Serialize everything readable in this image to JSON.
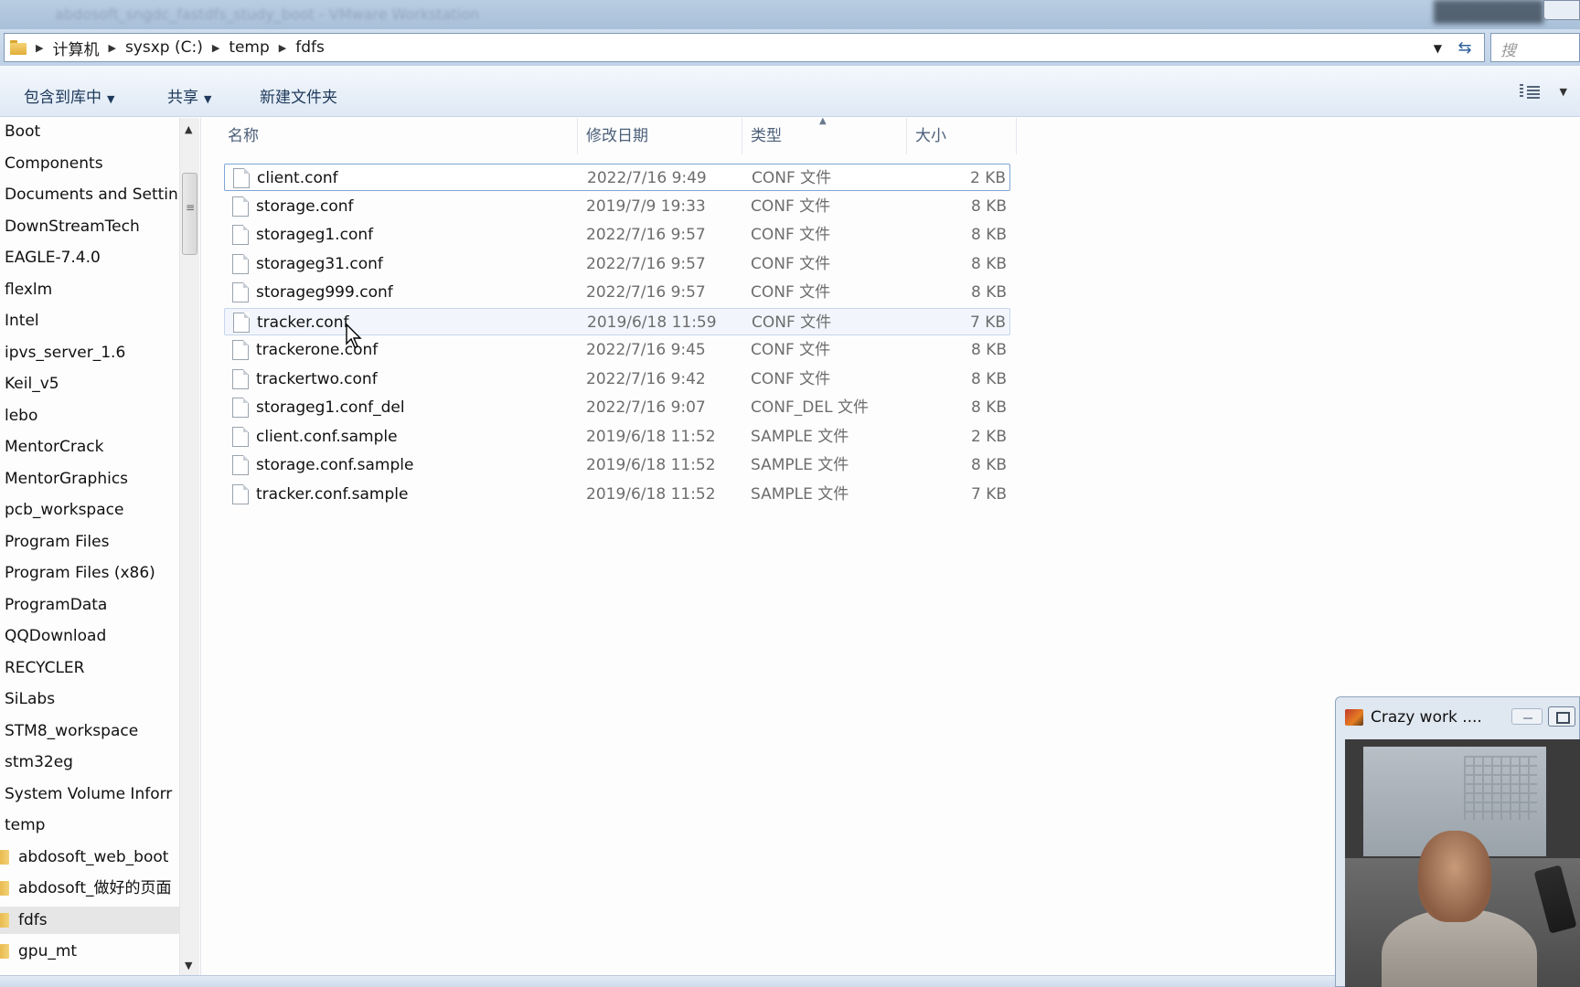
{
  "window": {
    "title_blurred": "abdosoft_sngdc_fastdfs_study_boot - VMware Workstation"
  },
  "address_bar": {
    "crumbs": [
      "计算机",
      "sysxp (C:)",
      "temp",
      "fdfs"
    ],
    "search_placeholder": "搜"
  },
  "toolbar": {
    "include_library": "包含到库中",
    "share": "共享",
    "new_folder": "新建文件夹"
  },
  "nav": {
    "items": [
      "Boot",
      "Components",
      "Documents and Settin",
      "DownStreamTech",
      "EAGLE-7.4.0",
      "flexlm",
      "Intel",
      "ipvs_server_1.6",
      "Keil_v5",
      "lebo",
      "MentorCrack",
      "MentorGraphics",
      "pcb_workspace",
      "Program Files",
      "Program Files (x86)",
      "ProgramData",
      "QQDownload",
      "RECYCLER",
      "SiLabs",
      "STM8_workspace",
      "stm32eg",
      "System Volume Inforr",
      "temp"
    ],
    "folders": [
      "abdosoft_web_boot",
      "abdosoft_做好的页面",
      "fdfs",
      "gpu_mt"
    ],
    "selected": "fdfs"
  },
  "columns": {
    "name": "名称",
    "date": "修改日期",
    "type": "类型",
    "size": "大小"
  },
  "files": [
    {
      "name": "client.conf",
      "date": "2022/7/16 9:49",
      "type": "CONF 文件",
      "size": "2 KB"
    },
    {
      "name": "storage.conf",
      "date": "2019/7/9 19:33",
      "type": "CONF 文件",
      "size": "8 KB"
    },
    {
      "name": "storageg1.conf",
      "date": "2022/7/16 9:57",
      "type": "CONF 文件",
      "size": "8 KB"
    },
    {
      "name": "storageg31.conf",
      "date": "2022/7/16 9:57",
      "type": "CONF 文件",
      "size": "8 KB"
    },
    {
      "name": "storageg999.conf",
      "date": "2022/7/16 9:57",
      "type": "CONF 文件",
      "size": "8 KB"
    },
    {
      "name": "tracker.conf",
      "date": "2019/6/18 11:59",
      "type": "CONF 文件",
      "size": "7 KB"
    },
    {
      "name": "trackerone.conf",
      "date": "2022/7/16 9:45",
      "type": "CONF 文件",
      "size": "8 KB"
    },
    {
      "name": "trackertwo.conf",
      "date": "2022/7/16 9:42",
      "type": "CONF 文件",
      "size": "8 KB"
    },
    {
      "name": "storageg1.conf_del",
      "date": "2022/7/16 9:07",
      "type": "CONF_DEL 文件",
      "size": "8 KB"
    },
    {
      "name": "client.conf.sample",
      "date": "2019/6/18 11:52",
      "type": "SAMPLE 文件",
      "size": "2 KB"
    },
    {
      "name": "storage.conf.sample",
      "date": "2019/6/18 11:52",
      "type": "SAMPLE 文件",
      "size": "8 KB"
    },
    {
      "name": "tracker.conf.sample",
      "date": "2019/6/18 11:52",
      "type": "SAMPLE 文件",
      "size": "7 KB"
    }
  ],
  "webcam": {
    "title": "Crazy work ...."
  }
}
